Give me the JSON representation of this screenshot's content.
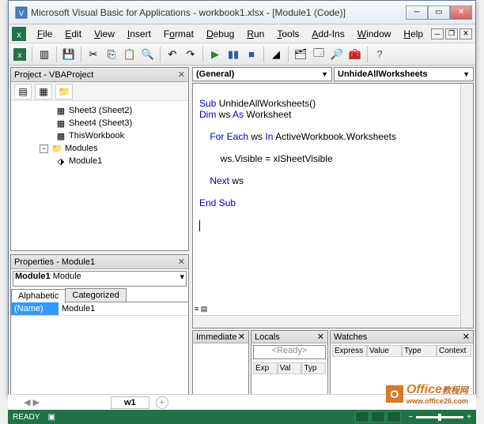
{
  "title": "Microsoft Visual Basic for Applications - workbook1.xlsx - [Module1 (Code)]",
  "menus": [
    "File",
    "Edit",
    "View",
    "Insert",
    "Format",
    "Debug",
    "Run",
    "Tools",
    "Add-Ins",
    "Window",
    "Help"
  ],
  "project": {
    "title": "Project - VBAProject",
    "nodes": {
      "sheet3": "Sheet3 (Sheet2)",
      "sheet4": "Sheet4 (Sheet3)",
      "thiswb": "ThisWorkbook",
      "modules": "Modules",
      "module1": "Module1"
    }
  },
  "properties": {
    "title": "Properties - Module1",
    "obj": "Module1",
    "objtype": "Module",
    "tabs": {
      "alpha": "Alphabetic",
      "cat": "Categorized"
    },
    "name_label": "(Name)",
    "name_value": "Module1"
  },
  "code": {
    "left_combo": "(General)",
    "right_combo": "UnhideAllWorksheets",
    "l1a": "Sub",
    "l1b": " UnhideAllWorksheets()",
    "l2a": "Dim",
    "l2b": " ws ",
    "l2c": "As",
    "l2d": " Worksheet",
    "l3a": "For Each",
    "l3b": " ws ",
    "l3c": "In",
    "l3d": " ActiveWorkbook.Worksheets",
    "l4": "ws.Visible = xlSheetVisible",
    "l5a": "Next",
    "l5b": " ws",
    "l6": "End Sub"
  },
  "immediate": {
    "title": "Immediate"
  },
  "locals": {
    "title": "Locals",
    "ready": "<Ready>",
    "cols": [
      "Exp",
      "Val",
      "Typ"
    ]
  },
  "watches": {
    "title": "Watches",
    "cols": [
      "Express",
      "Value",
      "Type",
      "Context"
    ]
  },
  "excel": {
    "sheet": "w1",
    "ready": "READY"
  },
  "watermark": {
    "brand": "Office",
    "sub": "教程网"
  }
}
